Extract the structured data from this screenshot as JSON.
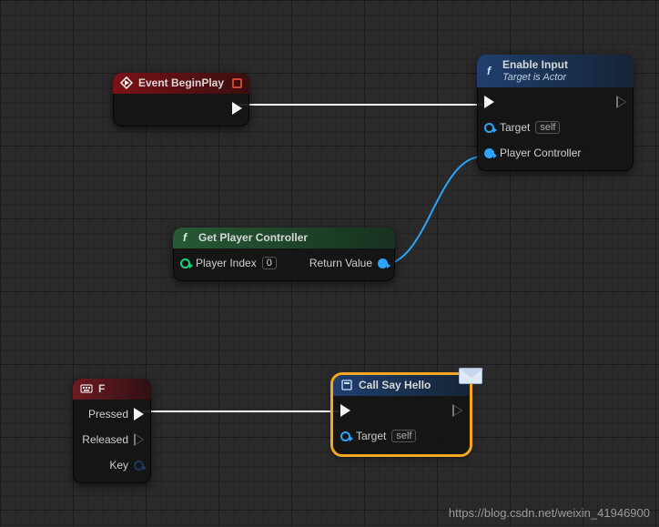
{
  "nodes": {
    "eventBeginPlay": {
      "title": "Event BeginPlay"
    },
    "enableInput": {
      "title": "Enable Input",
      "subtitle": "Target is Actor",
      "pins": {
        "target": "Target",
        "targetValue": "self",
        "playerController": "Player Controller"
      }
    },
    "getPlayerController": {
      "title": "Get Player Controller",
      "pins": {
        "playerIndex": "Player Index",
        "playerIndexValue": "0",
        "returnValue": "Return Value"
      }
    },
    "keyF": {
      "title": "F",
      "pins": {
        "pressed": "Pressed",
        "released": "Released",
        "key": "Key"
      }
    },
    "callSayHello": {
      "title": "Call Say Hello",
      "pins": {
        "target": "Target",
        "targetValue": "self"
      }
    }
  },
  "watermark": "https://blog.csdn.net/weixin_41946900"
}
